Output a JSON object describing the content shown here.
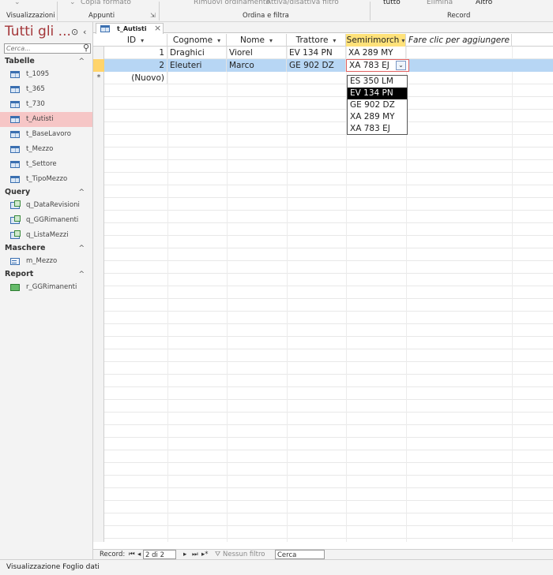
{
  "ribbon": {
    "top_items": [
      "Copia formato",
      "Rimuovi ordinamento",
      "Attiva/disattiva filtro",
      "tutto",
      "Elimina",
      "Altro"
    ],
    "groups": [
      "Visualizzazioni",
      "Appunti",
      "Ordina e filtra",
      "Record"
    ]
  },
  "nav": {
    "title": "Tutti gli ...",
    "search_placeholder": "Cerca...",
    "groups": [
      {
        "label": "Tabelle",
        "items": [
          "t_1095",
          "t_365",
          "t_730",
          "t_Autisti",
          "t_BaseLavoro",
          "t_Mezzo",
          "t_Settore",
          "t_TipoMezzo"
        ]
      },
      {
        "label": "Query",
        "items": [
          "q_DataRevisioni",
          "q_GGRimanenti",
          "q_ListaMezzi"
        ]
      },
      {
        "label": "Maschere",
        "items": [
          "m_Mezzo"
        ]
      },
      {
        "label": "Report",
        "items": [
          "r_GGRimanenti"
        ]
      }
    ],
    "selected": "t_Autisti"
  },
  "tab": {
    "label": "t_Autisti"
  },
  "table": {
    "columns": [
      "ID",
      "Cognome",
      "Nome",
      "Trattore",
      "Semirimorch",
      "Fare clic per aggiungere"
    ],
    "rows": [
      {
        "id": "1",
        "cognome": "Draghici",
        "nome": "Viorel",
        "trattore": "EV 134 PN",
        "semirimorchio": "XA 289 MY"
      },
      {
        "id": "2",
        "cognome": "Eleuteri",
        "nome": "Marco",
        "trattore": "GE 902 DZ",
        "semirimorchio": "XA 783 EJ"
      }
    ],
    "new_row_label": "(Nuovo)",
    "new_row_marker": "*"
  },
  "dropdown": {
    "options": [
      "ES 350 LM",
      "EV 134 PN",
      "GE 902 DZ",
      "XA 289 MY",
      "XA 783 EJ"
    ],
    "highlighted": "EV 134 PN"
  },
  "recnav": {
    "label": "Record:",
    "position": "2 di 2",
    "filter_label": "Nessun filtro",
    "search_label": "Cerca"
  },
  "status": {
    "text": "Visualizzazione Foglio dati"
  },
  "colors": {
    "accent": "#a4373a",
    "active_header": "#ffe27a",
    "current_row": "#b7d6f4",
    "selected_nav": "#f6c6c6"
  }
}
